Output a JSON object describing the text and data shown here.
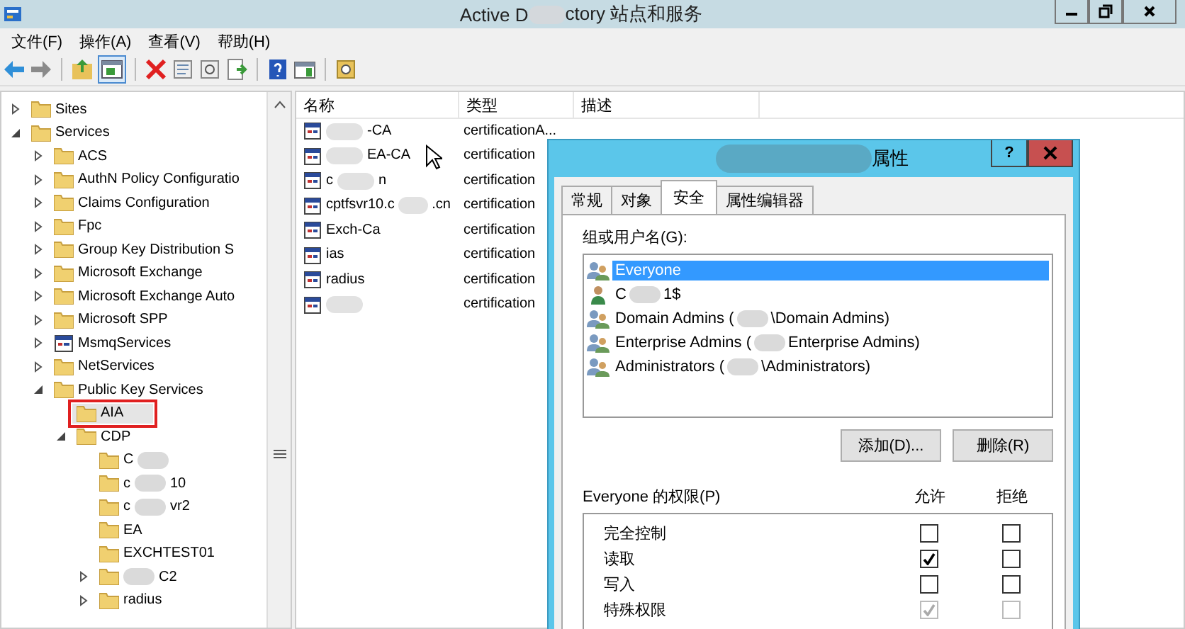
{
  "window": {
    "title_parts": [
      "Active D",
      {
        "blur": true
      },
      "ctory 站点和服务"
    ]
  },
  "menu": [
    "文件(F)",
    "操作(A)",
    "查看(V)",
    "帮助(H)"
  ],
  "toolbar": [
    {
      "kind": "back"
    },
    {
      "kind": "forward"
    },
    {
      "kind": "sep"
    },
    {
      "kind": "up"
    },
    {
      "kind": "tree"
    },
    {
      "kind": "sep"
    },
    {
      "kind": "delete"
    },
    {
      "kind": "props"
    },
    {
      "kind": "refresh"
    },
    {
      "kind": "export"
    },
    {
      "kind": "sep"
    },
    {
      "kind": "help"
    },
    {
      "kind": "pane"
    },
    {
      "kind": "sep"
    },
    {
      "kind": "find"
    }
  ],
  "tree": [
    {
      "label": [
        "Sites"
      ],
      "kind": "folder",
      "expanded": false,
      "selected": false
    },
    {
      "label": [
        "Services"
      ],
      "kind": "folder",
      "expanded": true,
      "selected": false,
      "children": [
        {
          "label": [
            "ACS"
          ],
          "kind": "folder",
          "expanded": false,
          "selected": false
        },
        {
          "label": [
            "AuthN Policy Configuratio"
          ],
          "kind": "folder",
          "expanded": false,
          "selected": false
        },
        {
          "label": [
            "Claims Configuration"
          ],
          "kind": "folder",
          "expanded": false,
          "selected": false
        },
        {
          "label": [
            "Fpc"
          ],
          "kind": "folder",
          "expanded": false,
          "selected": false
        },
        {
          "label": [
            "Group Key Distribution S"
          ],
          "kind": "folder",
          "expanded": false,
          "selected": false
        },
        {
          "label": [
            "Microsoft Exchange"
          ],
          "kind": "folder",
          "expanded": false,
          "selected": false
        },
        {
          "label": [
            "Microsoft Exchange Auto"
          ],
          "kind": "folder",
          "expanded": false,
          "selected": false
        },
        {
          "label": [
            "Microsoft SPP"
          ],
          "kind": "folder",
          "expanded": false,
          "selected": false
        },
        {
          "label": [
            "MsmqServices"
          ],
          "kind": "object",
          "expanded": false,
          "selected": false
        },
        {
          "label": [
            "NetServices"
          ],
          "kind": "folder",
          "expanded": false,
          "selected": false
        },
        {
          "label": [
            "Public Key Services"
          ],
          "kind": "folder",
          "expanded": true,
          "selected": false,
          "children": [
            {
              "label": [
                "AIA"
              ],
              "kind": "folder",
              "selected": true
            },
            {
              "label": [
                "CDP"
              ],
              "kind": "folder",
              "expanded": true,
              "selected": false,
              "children": [
                {
                  "label": [
                    "C",
                    {
                      "blur": true
                    }
                  ],
                  "kind": "folder",
                  "selected": false
                },
                {
                  "label": [
                    "c",
                    {
                      "blur": true
                    },
                    "10"
                  ],
                  "kind": "folder",
                  "selected": false
                },
                {
                  "label": [
                    "c",
                    {
                      "blur": true
                    },
                    "vr2"
                  ],
                  "kind": "folder",
                  "selected": false
                },
                {
                  "label": [
                    "EA"
                  ],
                  "kind": "folder",
                  "selected": false
                },
                {
                  "label": [
                    "EXCHTEST01"
                  ],
                  "kind": "folder",
                  "selected": false
                },
                {
                  "label": [
                    {
                      "blur": true
                    },
                    "C2"
                  ],
                  "kind": "folder",
                  "expanded": false,
                  "selected": false
                },
                {
                  "label": [
                    "radius"
                  ],
                  "kind": "folder",
                  "expanded": false,
                  "selected": false
                }
              ]
            }
          ]
        }
      ]
    }
  ],
  "list": {
    "columns": [
      "名称",
      "类型",
      "描述"
    ],
    "rows": [
      {
        "name": [
          {
            "blur": true
          },
          "-CA"
        ],
        "type": "certificationA..."
      },
      {
        "name": [
          {
            "blur": true
          },
          "EA-CA"
        ],
        "type": "certification"
      },
      {
        "name": [
          "c",
          {
            "blur": true
          },
          "n"
        ],
        "type": "certification"
      },
      {
        "name": [
          "cptfsvr10.c",
          {
            "blur": true
          },
          ".cn"
        ],
        "type": "certification"
      },
      {
        "name": [
          "Exch-Ca"
        ],
        "type": "certification"
      },
      {
        "name": [
          "ias"
        ],
        "type": "certification"
      },
      {
        "name": [
          "radius"
        ],
        "type": "certification"
      },
      {
        "name": [
          {
            "blur": true
          }
        ],
        "type": "certification"
      }
    ]
  },
  "dialog": {
    "title_parts": [
      {
        "blur": true
      },
      "属性"
    ],
    "help": "?",
    "tabs": [
      {
        "label": "常规",
        "selected": false
      },
      {
        "label": "对象",
        "selected": false
      },
      {
        "label": "安全",
        "selected": true
      },
      {
        "label": "属性编辑器",
        "selected": false
      }
    ],
    "users_label": "组或用户名(G):",
    "users": [
      {
        "name": [
          "Everyone"
        ],
        "kind": "group",
        "selected": true
      },
      {
        "name": [
          "C",
          {
            "blur": true
          },
          "1$"
        ],
        "kind": "user",
        "selected": false
      },
      {
        "name": [
          "Domain Admins (",
          {
            "blur": true
          },
          "\\Domain Admins)"
        ],
        "kind": "group",
        "selected": false
      },
      {
        "name": [
          "Enterprise Admins (",
          {
            "blur": true
          },
          "Enterprise Admins)"
        ],
        "kind": "group",
        "selected": false
      },
      {
        "name": [
          "Administrators (",
          {
            "blur": true
          },
          "\\Administrators)"
        ],
        "kind": "group",
        "selected": false
      }
    ],
    "buttons": [
      "添加(D)...",
      "删除(R)"
    ],
    "perm_label": "Everyone 的权限(P)",
    "allow_label": "允许",
    "deny_label": "拒绝",
    "permissions": [
      {
        "name": "完全控制",
        "allow": false,
        "deny": false,
        "disabled": false
      },
      {
        "name": "读取",
        "allow": true,
        "deny": false,
        "disabled": false
      },
      {
        "name": "写入",
        "allow": false,
        "deny": false,
        "disabled": false
      },
      {
        "name": "特殊权限",
        "allow": true,
        "deny": false,
        "disabled": true
      }
    ]
  }
}
